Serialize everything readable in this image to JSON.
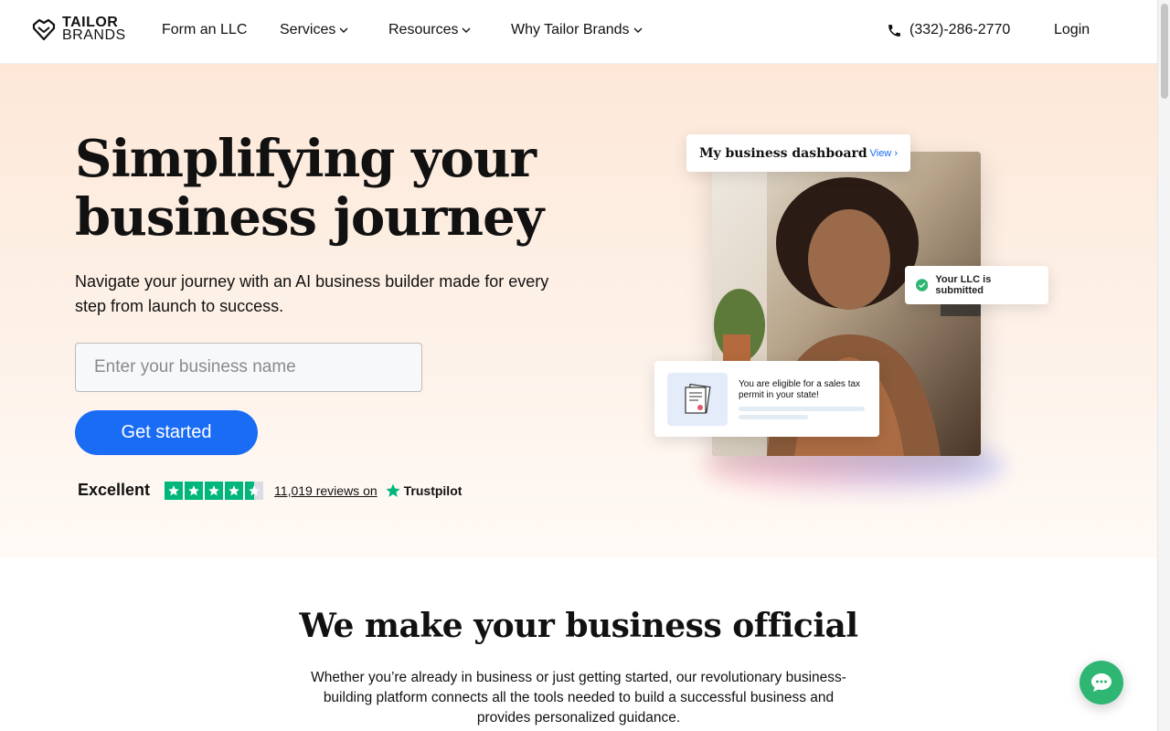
{
  "header": {
    "logo_line1": "TAILOR",
    "logo_line2": "BRANDS",
    "nav": [
      {
        "label": "Form an LLC",
        "has_dropdown": false
      },
      {
        "label": "Services",
        "has_dropdown": true
      },
      {
        "label": "Resources",
        "has_dropdown": true
      },
      {
        "label": "Why Tailor Brands",
        "has_dropdown": true
      }
    ],
    "phone": "(332)-286-2770",
    "login": "Login"
  },
  "hero": {
    "title": "Simplifying your business journey",
    "subtitle": "Navigate your journey with an AI business builder made for every step from launch to success.",
    "input_placeholder": "Enter your business name",
    "input_value": "",
    "cta": "Get started",
    "trustpilot": {
      "rating_word": "Excellent",
      "stars": 4.5,
      "reviews_text": "11,019 reviews on",
      "brand": "Trustpilot"
    },
    "cards": {
      "dashboard_title": "My business dashboard",
      "dashboard_link": "View",
      "llc_status": "Your LLC is submitted",
      "tax_notice": "You are eligible for a sales tax permit in your state!"
    }
  },
  "section2": {
    "title": "We make your business official",
    "body": "Whether you’re already in business or just getting started, our revolutionary business-building platform connects all the tools needed to build a successful business and provides personalized guidance."
  },
  "colors": {
    "accent": "#1a6cf5",
    "trustpilot_green": "#00b67a",
    "chat_green": "#2fb673",
    "hero_bg_top": "#fde8d8"
  },
  "icons": {
    "logo": "heart-shield-icon",
    "phone": "phone-icon",
    "chevron": "chevron-down-icon",
    "check": "check-circle-icon",
    "document": "document-icon",
    "chat": "chat-bubble-icon",
    "star": "star-icon"
  }
}
